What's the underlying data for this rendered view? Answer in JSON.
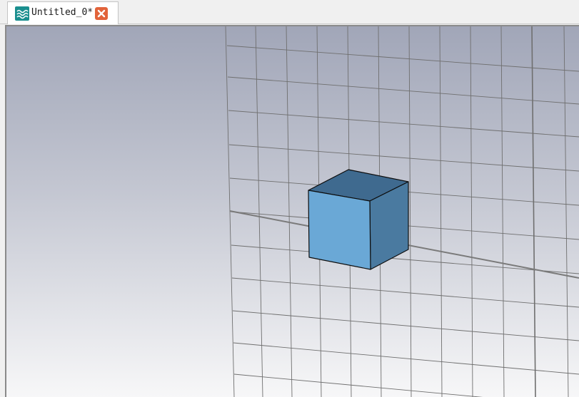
{
  "document_tab": {
    "title": "Untitled_0*",
    "app_icon": "waves-icon",
    "close_icon": "close-icon"
  },
  "viewport": {
    "background_top_color": "#a1a6b8",
    "background_bottom_color": "#f7f7f8",
    "grid_color": "#6f6f6f",
    "axis_color": "#7a7a7a",
    "object": {
      "type": "cube",
      "front_color": "#6aa8d6",
      "top_color": "#3f6a8f",
      "side_color": "#4a7aa0"
    }
  },
  "colors": {
    "tab_background": "#ffffff",
    "app_icon_background": "#1a8f8f",
    "close_button": "#e2633a"
  }
}
